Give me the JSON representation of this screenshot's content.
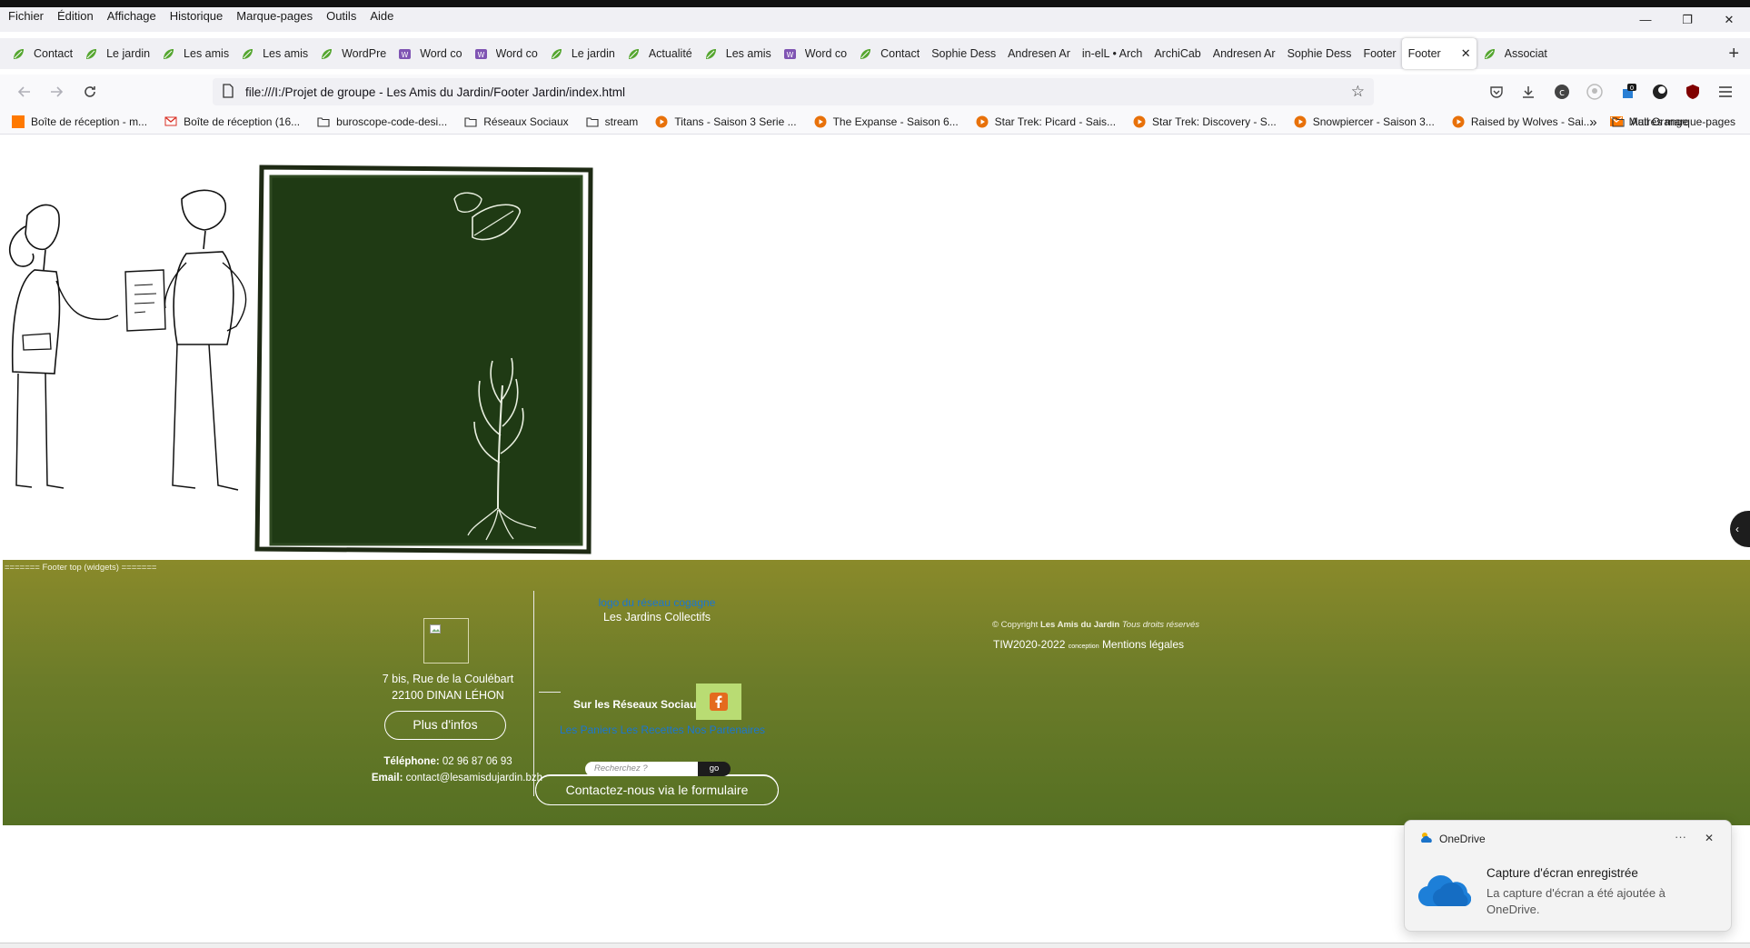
{
  "menu": [
    "Fichier",
    "Édition",
    "Affichage",
    "Historique",
    "Marque-pages",
    "Outils",
    "Aide"
  ],
  "window_controls": {
    "minimize": "—",
    "restore": "❐",
    "close": "✕"
  },
  "tabs": [
    {
      "label": "Contact",
      "icon": "leaf-icon"
    },
    {
      "label": "Le jardin",
      "icon": "leaf-icon"
    },
    {
      "label": "Les amis",
      "icon": "leaf-icon"
    },
    {
      "label": "Les amis",
      "icon": "leaf-icon"
    },
    {
      "label": "WordPre",
      "icon": "leaf-icon"
    },
    {
      "label": "Word co",
      "icon": "woo-icon"
    },
    {
      "label": "Word co",
      "icon": "woo-icon"
    },
    {
      "label": "Le jardin",
      "icon": "leaf-icon"
    },
    {
      "label": "Actualité",
      "icon": "leaf-icon"
    },
    {
      "label": "Les amis",
      "icon": "leaf-icon"
    },
    {
      "label": "Word co",
      "icon": "woo-icon"
    },
    {
      "label": "Contact",
      "icon": "leaf-icon"
    },
    {
      "label": "Sophie Dess",
      "icon": ""
    },
    {
      "label": "Andresen Ar",
      "icon": ""
    },
    {
      "label": "in-elL • Arch",
      "icon": ""
    },
    {
      "label": "ArchiCab",
      "icon": ""
    },
    {
      "label": "Andresen Ar",
      "icon": ""
    },
    {
      "label": "Sophie Dess",
      "icon": ""
    },
    {
      "label": "Footer",
      "icon": ""
    },
    {
      "label": "Footer",
      "icon": "",
      "active": true
    },
    {
      "label": "Associat",
      "icon": "leaf-icon"
    }
  ],
  "tab_close": "✕",
  "new_tab": "+",
  "url": "file:///I:/Projet de groupe - Les Amis du Jardin/Footer Jardin/index.html",
  "bookmarks": [
    {
      "label": "Boîte de réception - m...",
      "icon": "mail-orange-icon"
    },
    {
      "label": "Boîte de réception (16...",
      "icon": "gmail-icon"
    },
    {
      "label": "buroscope-code-desi...",
      "icon": "folder-icon"
    },
    {
      "label": "Réseaux Sociaux",
      "icon": "folder-icon"
    },
    {
      "label": "stream",
      "icon": "folder-icon"
    },
    {
      "label": "Titans - Saison 3 Serie ...",
      "icon": "play-icon"
    },
    {
      "label": "The Expanse - Saison 6...",
      "icon": "play-icon"
    },
    {
      "label": "Star Trek: Picard - Sais...",
      "icon": "play-icon"
    },
    {
      "label": "Star Trek: Discovery - S...",
      "icon": "play-icon"
    },
    {
      "label": "Snowpiercer - Saison 3...",
      "icon": "play-icon"
    },
    {
      "label": "Raised by Wolves - Sai...",
      "icon": "play-icon"
    },
    {
      "label": "Mail Orange",
      "icon": "mail-icon"
    }
  ],
  "bookmarks_overflow": "»",
  "bookmarks_other": "Autres marque-pages",
  "footer": {
    "tag": "======= Footer top (widgets) =======",
    "address_line1": "7 bis, Rue de la Coulébart",
    "address_line2": "22100 DINAN LÉHON",
    "more_info": "Plus d'infos",
    "phone_label": "Téléphone:",
    "phone": "02 96 87 06 93",
    "email_label": "Email:",
    "email": "contact@lesamisdujardin.bzh",
    "network_logo": "logo du réseau cogagne",
    "network_name": "Les Jardins Collectifs",
    "contact_btn": "Contactez-nous via le formulaire",
    "social_label": "Sur les Réseaux Sociaux",
    "links": "Les Paniers Les Recettes Nos Partenaires",
    "search_placeholder": "Recherchez ?",
    "search_go": "go",
    "copyright_prefix": "© Copyright",
    "copyright_brand": "Les Amis du Jardin",
    "copyright_suffix": "Tous droits réservés",
    "tiw": "TIW2020-2022",
    "conception": "conception",
    "legal": "Mentions légales"
  },
  "toast": {
    "app": "OneDrive",
    "more": "···",
    "close": "✕",
    "title": "Capture d'écran enregistrée",
    "body": "La capture d'écran a été ajoutée à OneDrive."
  },
  "colors": {
    "footer_top": "#8a8a2a",
    "footer_bottom": "#557023",
    "board": "#1e3314",
    "link": "#1a76d2",
    "facebook_tile": "#b9dc73"
  }
}
